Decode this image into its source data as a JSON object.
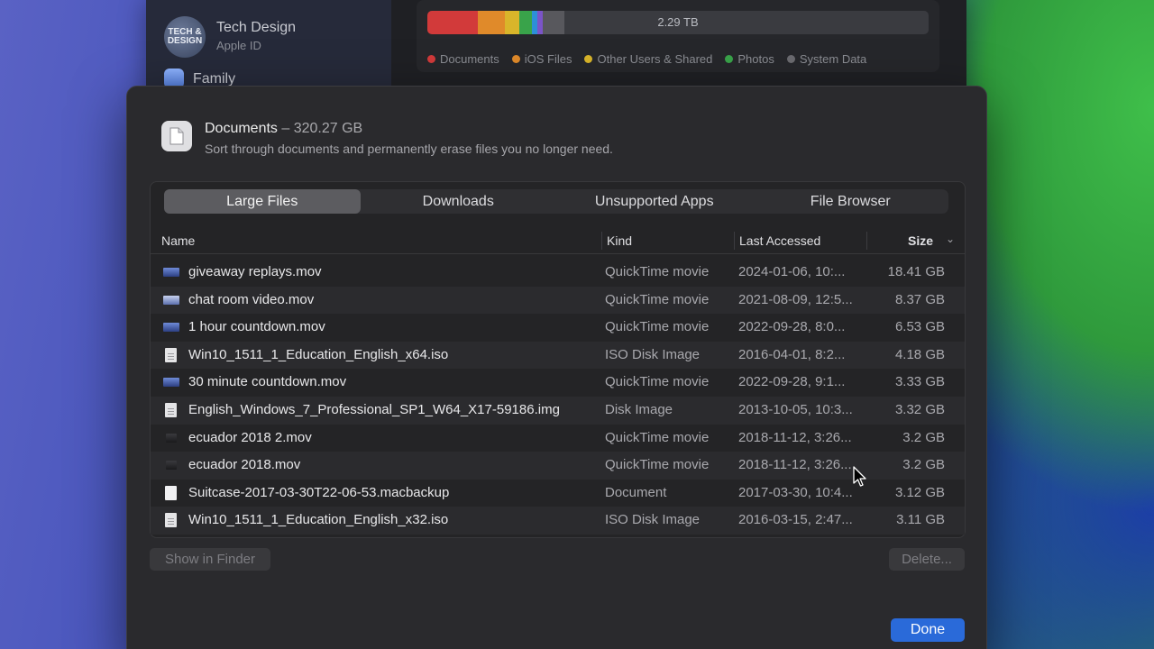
{
  "background_window": {
    "account_name": "Tech Design",
    "account_sub": "Apple ID",
    "avatar_text": "TECH & DESIGN",
    "family_label": "Family",
    "storage_total": "2.29 TB",
    "legend": [
      {
        "label": "Documents",
        "color": "#d23a3a"
      },
      {
        "label": "iOS Files",
        "color": "#e08a2a"
      },
      {
        "label": "Other Users & Shared",
        "color": "#d9b52a"
      },
      {
        "label": "Photos",
        "color": "#39a34a"
      },
      {
        "label": "System Data",
        "color": "#6b6b70"
      }
    ]
  },
  "dialog": {
    "title": "Documents",
    "title_separator": " – ",
    "title_size": "320.27 GB",
    "subtitle": "Sort through documents and permanently erase files you no longer need.",
    "tabs": [
      {
        "label": "Large Files",
        "active": true
      },
      {
        "label": "Downloads",
        "active": false
      },
      {
        "label": "Unsupported Apps",
        "active": false
      },
      {
        "label": "File Browser",
        "active": false
      }
    ],
    "columns": {
      "name": "Name",
      "kind": "Kind",
      "last_accessed": "Last Accessed",
      "size": "Size"
    },
    "rows": [
      {
        "name": "giveaway replays.mov",
        "kind": "QuickTime movie",
        "date": "2024-01-06, 10:...",
        "size": "18.41 GB",
        "icon": "movie-icon"
      },
      {
        "name": "chat room video.mov",
        "kind": "QuickTime movie",
        "date": "2021-08-09, 12:5...",
        "size": "8.37 GB",
        "icon": "movie-icon"
      },
      {
        "name": "1 hour countdown.mov",
        "kind": "QuickTime movie",
        "date": "2022-09-28, 8:0...",
        "size": "6.53 GB",
        "icon": "movie-icon"
      },
      {
        "name": "Win10_1511_1_Education_English_x64.iso",
        "kind": "ISO Disk Image",
        "date": "2016-04-01, 8:2...",
        "size": "4.18 GB",
        "icon": "document-icon"
      },
      {
        "name": "30 minute countdown.mov",
        "kind": "QuickTime movie",
        "date": "2022-09-28, 9:1...",
        "size": "3.33 GB",
        "icon": "movie-icon"
      },
      {
        "name": "English_Windows_7_Professional_SP1_W64_X17-59186.img",
        "kind": "Disk Image",
        "date": "2013-10-05, 10:3...",
        "size": "3.32 GB",
        "icon": "document-icon"
      },
      {
        "name": "ecuador 2018 2.mov",
        "kind": "QuickTime movie",
        "date": "2018-11-12, 3:26...",
        "size": "3.2 GB",
        "icon": "movie-icon"
      },
      {
        "name": "ecuador 2018.mov",
        "kind": "QuickTime movie",
        "date": "2018-11-12, 3:26...",
        "size": "3.2 GB",
        "icon": "movie-icon"
      },
      {
        "name": "Suitcase-2017-03-30T22-06-53.macbackup",
        "kind": "Document",
        "date": "2017-03-30, 10:4...",
        "size": "3.12 GB",
        "icon": "blank-document-icon"
      },
      {
        "name": "Win10_1511_1_Education_English_x32.iso",
        "kind": "ISO Disk Image",
        "date": "2016-03-15, 2:47...",
        "size": "3.11 GB",
        "icon": "document-icon"
      }
    ],
    "show_in_finder_label": "Show in Finder",
    "delete_label": "Delete...",
    "done_label": "Done"
  }
}
